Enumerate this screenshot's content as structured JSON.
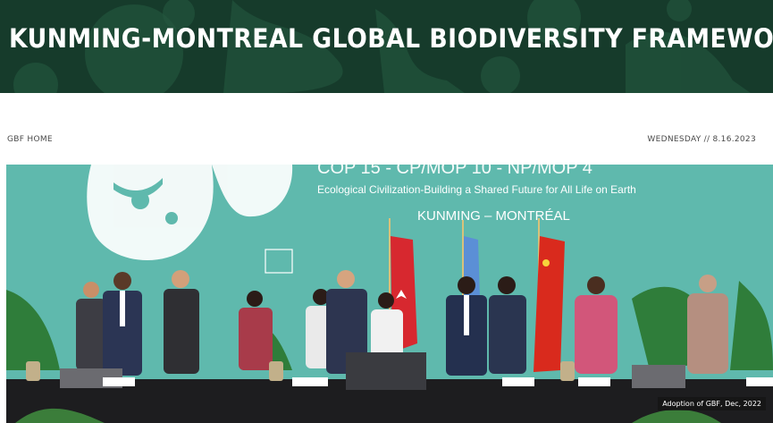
{
  "header": {
    "title": "KUNMING-MONTREAL GLOBAL BIODIVERSITY FRAMEWORK"
  },
  "nav": {
    "home_link": "GBF HOME",
    "date": "WEDNESDAY // 8.16.2023"
  },
  "hero": {
    "backdrop_top": "COP 15 - CP/MOP 10 - NP/MOP 4",
    "backdrop_tagline": "Ecological Civilization-Building a Shared Future for All Life on Earth",
    "backdrop_location": "KUNMING – MONTRÉAL",
    "caption": "Adoption of GBF, Dec, 2022",
    "flags": [
      "Canada",
      "United Nations",
      "China"
    ]
  },
  "colors": {
    "banner": "#163b2b",
    "backdrop": "#5fb9ad",
    "text_muted": "#4a4a4a"
  }
}
